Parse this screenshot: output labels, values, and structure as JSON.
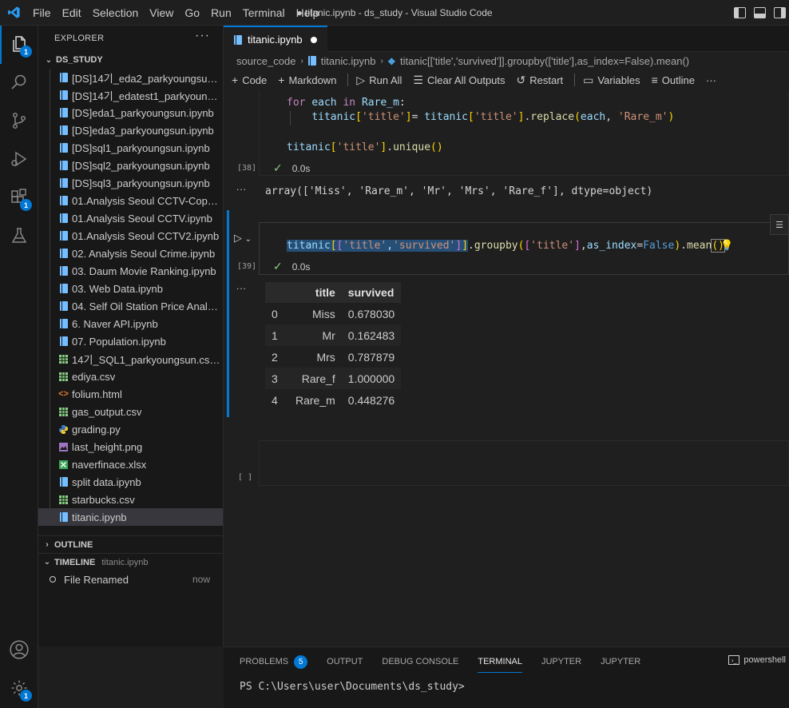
{
  "titlebar": {
    "menu": [
      "File",
      "Edit",
      "Selection",
      "View",
      "Go",
      "Run",
      "Terminal",
      "Help"
    ],
    "title": "● titanic.ipynb - ds_study - Visual Studio Code"
  },
  "activity": {
    "explorer_badge": "1",
    "extensions_badge": "1",
    "settings_badge": "1"
  },
  "sidebar": {
    "header": "EXPLORER",
    "more": "···",
    "folder": "DS_STUDY",
    "files": [
      {
        "name": "[DS]14기_eda2_parkyoungsun.i...",
        "icon": "notebook-icon"
      },
      {
        "name": "[DS]14기_edatest1_parkyoungs...",
        "icon": "notebook-icon"
      },
      {
        "name": "[DS]eda1_parkyoungsun.ipynb",
        "icon": "notebook-icon"
      },
      {
        "name": "[DS]eda3_parkyoungsun.ipynb",
        "icon": "notebook-icon"
      },
      {
        "name": "[DS]sql1_parkyoungsun.ipynb",
        "icon": "notebook-icon"
      },
      {
        "name": "[DS]sql2_parkyoungsun.ipynb",
        "icon": "notebook-icon"
      },
      {
        "name": "[DS]sql3_parkyoungsun.ipynb",
        "icon": "notebook-icon"
      },
      {
        "name": "01.Analysis Seoul CCTV-Copy1....",
        "icon": "notebook-icon"
      },
      {
        "name": "01.Analysis Seoul CCTV.ipynb",
        "icon": "notebook-icon"
      },
      {
        "name": "01.Analysis Seoul CCTV2.ipynb",
        "icon": "notebook-icon"
      },
      {
        "name": "02. Analysis Seoul Crime.ipynb",
        "icon": "notebook-icon"
      },
      {
        "name": "03. Daum Movie Ranking.ipynb",
        "icon": "notebook-icon"
      },
      {
        "name": "03. Web Data.ipynb",
        "icon": "notebook-icon"
      },
      {
        "name": "04. Self Oil Station Price Analys...",
        "icon": "notebook-icon"
      },
      {
        "name": "6. Naver API.ipynb",
        "icon": "notebook-icon"
      },
      {
        "name": "07. Population.ipynb",
        "icon": "notebook-icon"
      },
      {
        "name": "14기_SQL1_parkyoungsun.csv.c...",
        "icon": "csv-icon"
      },
      {
        "name": "ediya.csv",
        "icon": "csv-icon"
      },
      {
        "name": "folium.html",
        "icon": "html-icon"
      },
      {
        "name": "gas_output.csv",
        "icon": "csv-icon"
      },
      {
        "name": "grading.py",
        "icon": "python-icon"
      },
      {
        "name": "last_height.png",
        "icon": "image-icon"
      },
      {
        "name": "naverfinace.xlsx",
        "icon": "excel-icon"
      },
      {
        "name": "split data.ipynb",
        "icon": "notebook-icon"
      },
      {
        "name": "starbucks.csv",
        "icon": "csv-icon"
      },
      {
        "name": "titanic.ipynb",
        "icon": "notebook-icon"
      }
    ],
    "outline_label": "OUTLINE",
    "timeline_label": "TIMELINE",
    "timeline_file": "titanic.ipynb",
    "timeline_item": "File Renamed",
    "timeline_when": "now"
  },
  "editor": {
    "tab_label": "titanic.ipynb",
    "breadcrumb": [
      "source_code",
      "titanic.ipynb",
      "titanic[['title','survived']].groupby(['title'],as_index=False).mean()"
    ],
    "toolbar": {
      "code": "Code",
      "markdown": "Markdown",
      "run_all": "Run All",
      "clear_outputs": "Clear All Outputs",
      "restart": "Restart",
      "variables": "Variables",
      "outline": "Outline",
      "more": "···"
    }
  },
  "cells": {
    "c38": {
      "count": "[38]",
      "time": "0.0s",
      "output": "array(['Miss', 'Rare_m', 'Mr', 'Mrs', 'Rare_f'], dtype=object)"
    },
    "c39": {
      "count": "[39]",
      "time": "0.0s",
      "columns": [
        "",
        "title",
        "survived"
      ],
      "rows": [
        [
          "0",
          "Miss",
          "0.678030"
        ],
        [
          "1",
          "Mr",
          "0.162483"
        ],
        [
          "2",
          "Mrs",
          "0.787879"
        ],
        [
          "3",
          "Rare_f",
          "1.000000"
        ],
        [
          "4",
          "Rare_m",
          "0.448276"
        ]
      ]
    },
    "empty": {
      "count": "[ ]"
    },
    "output_dots": "..."
  },
  "panel": {
    "tabs": [
      "PROBLEMS",
      "OUTPUT",
      "DEBUG CONSOLE",
      "TERMINAL",
      "JUPYTER",
      "JUPYTER"
    ],
    "problems_count": "5",
    "shell": "powershell",
    "prompt": "PS C:\\Users\\user\\Documents\\ds_study>"
  }
}
